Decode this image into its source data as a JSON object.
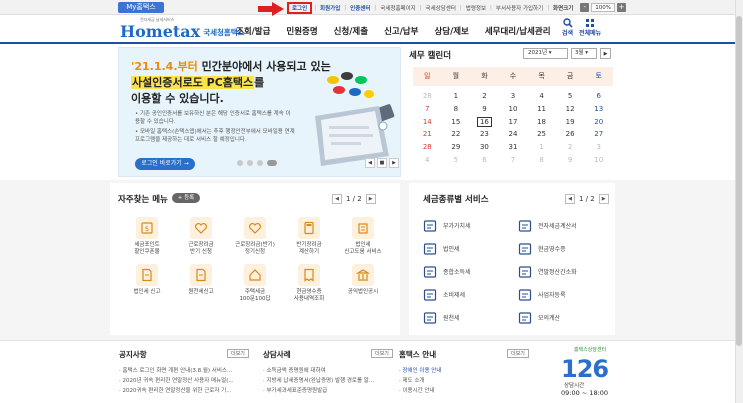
{
  "topbar": {
    "my_hometax": "My홈택스",
    "util_links": [
      {
        "label": "로그인",
        "style": "login"
      },
      {
        "label": "회원가입",
        "style": "blue"
      },
      {
        "label": "인증센터",
        "style": "blue"
      },
      {
        "label": "국세청홈페이지",
        "style": ""
      },
      {
        "label": "국세상담센터",
        "style": ""
      },
      {
        "label": "법령정보",
        "style": ""
      },
      {
        "label": "부서사용자 가입하기",
        "style": ""
      },
      {
        "label": "화면크기",
        "style": "bold"
      }
    ],
    "zoom_value": "100%",
    "zoom_minus": "-",
    "zoom_plus": "+"
  },
  "header": {
    "logo_main": "Hometax",
    "logo_sub": "국세청홈택스",
    "logo_tiny": "전자세금 납세서비스",
    "gnb": [
      "조회/발급",
      "민원증명",
      "신청/제출",
      "신고/납부",
      "상담/제보",
      "세무대리/납세관리"
    ],
    "search_label": "검색",
    "menu_label": "전체메뉴"
  },
  "banner": {
    "line1_highlight": "'21.1.4.부터",
    "line1_rest": " 민간분야에서 사용되고 있는",
    "line2_mark": "사설인증서로도 PC홈택스",
    "line2_rest": "를",
    "line3": "이용할 수 있습니다.",
    "desc1": "• 기존 공인인증서를 보유하신 분은 해당 인증서로 홈택스를 계속 이용할 수 있습니다.",
    "desc2": "• 모바일 홈택스(손택스앱)에서는 추후 행정안전부에서 모바일용 연계프로그램을 제공하는 대로 서비스 할 예정입니다.",
    "button": "로그인 바로가기 →",
    "ctrl_prev": "◀",
    "ctrl_stop": "■",
    "ctrl_next": "▶",
    "slides": 4,
    "active_slide": 3
  },
  "calendar": {
    "title": "세무 캘린더",
    "year": "2021년",
    "month": "3월",
    "next": "▶",
    "weekdays": [
      "일",
      "월",
      "화",
      "수",
      "목",
      "금",
      "토"
    ],
    "days": [
      {
        "d": "28",
        "t": "dim"
      },
      {
        "d": "1",
        "t": ""
      },
      {
        "d": "2",
        "t": ""
      },
      {
        "d": "3",
        "t": ""
      },
      {
        "d": "4",
        "t": ""
      },
      {
        "d": "5",
        "t": ""
      },
      {
        "d": "6",
        "t": "sat"
      },
      {
        "d": "7",
        "t": "sun"
      },
      {
        "d": "8",
        "t": ""
      },
      {
        "d": "9",
        "t": ""
      },
      {
        "d": "10",
        "t": ""
      },
      {
        "d": "11",
        "t": ""
      },
      {
        "d": "12",
        "t": ""
      },
      {
        "d": "13",
        "t": "sat"
      },
      {
        "d": "14",
        "t": "sun"
      },
      {
        "d": "15",
        "t": ""
      },
      {
        "d": "16",
        "t": "today"
      },
      {
        "d": "17",
        "t": ""
      },
      {
        "d": "18",
        "t": ""
      },
      {
        "d": "19",
        "t": ""
      },
      {
        "d": "20",
        "t": "sat"
      },
      {
        "d": "21",
        "t": "sun"
      },
      {
        "d": "22",
        "t": ""
      },
      {
        "d": "23",
        "t": ""
      },
      {
        "d": "24",
        "t": ""
      },
      {
        "d": "25",
        "t": ""
      },
      {
        "d": "26",
        "t": ""
      },
      {
        "d": "27",
        "t": "sat"
      },
      {
        "d": "28",
        "t": "sun"
      },
      {
        "d": "29",
        "t": ""
      },
      {
        "d": "30",
        "t": ""
      },
      {
        "d": "31",
        "t": ""
      },
      {
        "d": "1",
        "t": "dim"
      },
      {
        "d": "2",
        "t": "dim"
      },
      {
        "d": "3",
        "t": "dim"
      },
      {
        "d": "4",
        "t": "dim"
      },
      {
        "d": "5",
        "t": "dim"
      },
      {
        "d": "6",
        "t": "dim"
      },
      {
        "d": "7",
        "t": "dim"
      },
      {
        "d": "8",
        "t": "dim"
      },
      {
        "d": "9",
        "t": "dim"
      },
      {
        "d": "10",
        "t": "dim"
      }
    ]
  },
  "favorites": {
    "title": "자주찾는 메뉴",
    "register": "+ 등록",
    "page": "1 / 2",
    "prev": "◀",
    "next": "▶",
    "items": [
      {
        "label": "세금포인트\n할인쿠폰몰",
        "icon": "coupon-icon"
      },
      {
        "label": "근로장려금\n반기 신청",
        "icon": "heart-icon"
      },
      {
        "label": "근로장려금(반기)\n정기신청",
        "icon": "heart-icon"
      },
      {
        "label": "반기장려금\n계산하기",
        "icon": "calc-icon"
      },
      {
        "label": "법인세\n신고도움 서비스",
        "icon": "building-icon"
      },
      {
        "label": "법인세 신고",
        "icon": "document-icon"
      },
      {
        "label": "원천세신고",
        "icon": "document-icon"
      },
      {
        "label": "주택세금\n100문100답",
        "icon": "house-icon"
      },
      {
        "label": "현금영수증\n사용내역조회",
        "icon": "receipt-icon"
      },
      {
        "label": "공익법인공시",
        "icon": "bank-icon"
      }
    ]
  },
  "tax_services": {
    "title": "세금종류별 서비스",
    "page": "1 / 2",
    "prev": "◀",
    "next": "▶",
    "items": [
      {
        "label": "부가가치세",
        "icon": "vat-icon"
      },
      {
        "label": "전자세금계산서",
        "icon": "invoice-icon"
      },
      {
        "label": "법인세",
        "icon": "corp-icon"
      },
      {
        "label": "현금영수증",
        "icon": "cash-receipt-icon"
      },
      {
        "label": "종합소득세",
        "icon": "income-icon"
      },
      {
        "label": "연말정산간소화",
        "icon": "year-end-icon"
      },
      {
        "label": "소비제세",
        "icon": "consumption-icon"
      },
      {
        "label": "사업자등록",
        "icon": "business-icon"
      },
      {
        "label": "원천세",
        "icon": "withholding-icon"
      },
      {
        "label": "모의계산",
        "icon": "simulation-icon"
      }
    ]
  },
  "notices": {
    "title": "공지사항",
    "more": "더보기",
    "items": [
      "홈택스 로그인 화면 개편 안내(3.8.월) 서비스...",
      "2020년 귀속 편리한 연말정산 사용자 매뉴얼(...",
      "2020귀속 편리한 연말정산을 위한 근로자 기..."
    ]
  },
  "cases": {
    "title": "상담사례",
    "more": "더보기",
    "items": [
      "소득금액 증명원에 대하여",
      "지방세 납세증명서(완납증명) 발행 경로를 알...",
      "부가세과세표준증명원발급"
    ]
  },
  "guide": {
    "title": "홈택스 안내",
    "more": "더보기",
    "items": [
      "장애인 이용 안내",
      "제도 소개",
      "이용시간 안내"
    ]
  },
  "consult": {
    "deco": "홈택스상담센터",
    "number": "126",
    "label": "상담시간",
    "time": "09:00 ~ 18:00"
  },
  "colors": {
    "brand_blue": "#1e4ea6",
    "accent_orange": "#f08a00",
    "login_highlight": "#e02020",
    "sunday": "#d83a2a",
    "saturday": "#1e4ea6"
  }
}
